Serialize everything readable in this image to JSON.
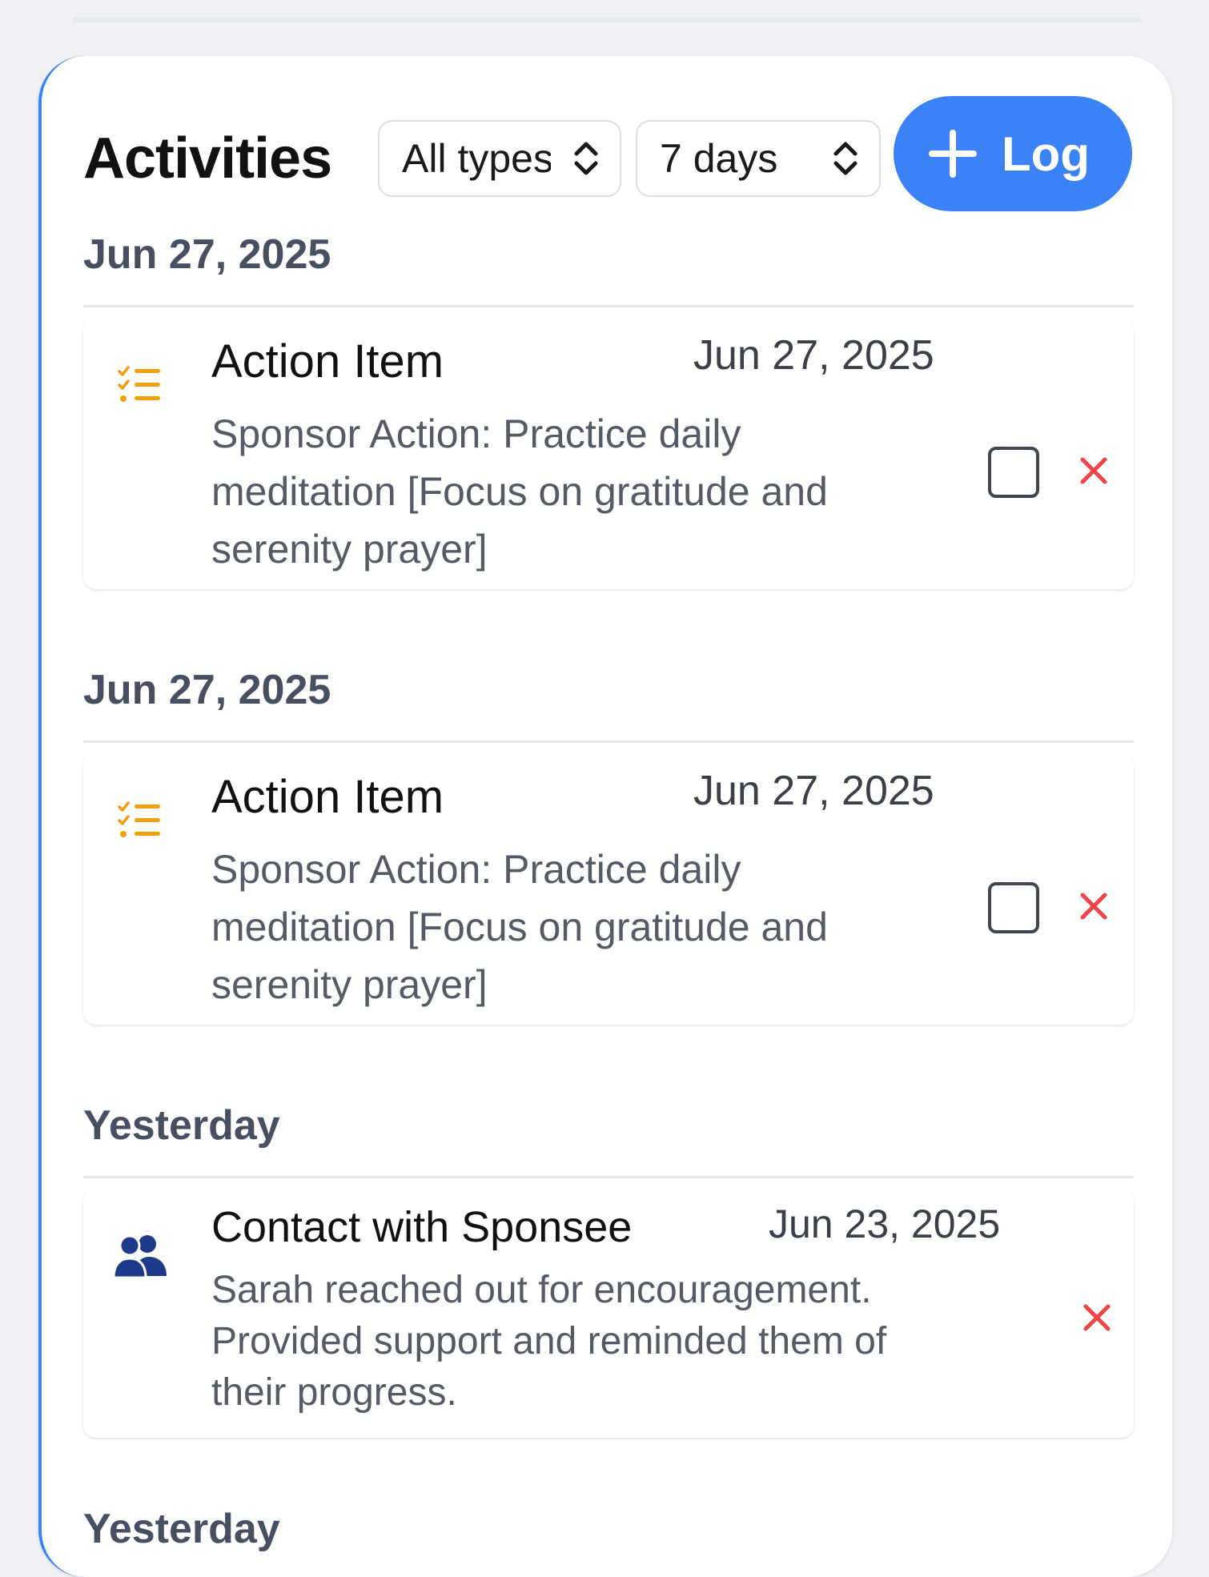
{
  "header": {
    "title": "Activities",
    "type_filter": {
      "selected": "All types"
    },
    "range_filter": {
      "selected": "7 days"
    },
    "log_button_label": "Log"
  },
  "groups": [
    {
      "label": "Jun 27, 2025",
      "items": [
        {
          "icon": "action-item-list-icon",
          "title": "Action Item",
          "date": "Jun 27, 2025",
          "description": "Sponsor Action: Practice daily meditation [Focus on gratitude and serenity prayer]",
          "desc_lines": [
            "Sponsor Action: Practice daily",
            "meditation [Focus on gratitude and",
            "serenity prayer]"
          ],
          "completed": false
        }
      ]
    },
    {
      "label": "Jun 27, 2025",
      "items": [
        {
          "icon": "action-item-list-icon",
          "title": "Action Item",
          "date": "Jun 27, 2025",
          "description": "Sponsor Action: Practice daily meditation [Focus on gratitude and serenity prayer]",
          "desc_lines": [
            "Sponsor Action: Practice daily",
            "meditation [Focus on gratitude and",
            "serenity prayer]"
          ],
          "completed": false
        }
      ]
    },
    {
      "label": "Yesterday",
      "items": [
        {
          "icon": "users-icon",
          "title": "Contact with Sponsee",
          "date": "Jun 23, 2025",
          "description": "Sarah reached out for encouragement. Provided support and reminded them of their progress.",
          "desc_lines": [
            "Sarah reached out for encouragement.",
            "Provided support and reminded them of",
            "their progress."
          ]
        }
      ]
    },
    {
      "label": "Yesterday",
      "items": []
    }
  ],
  "colors": {
    "accent": "#3b82f6",
    "action_icon": "#f59e0b",
    "contact_icon": "#1e3a8a",
    "delete": "#ef4444",
    "group_header": "#475062"
  }
}
